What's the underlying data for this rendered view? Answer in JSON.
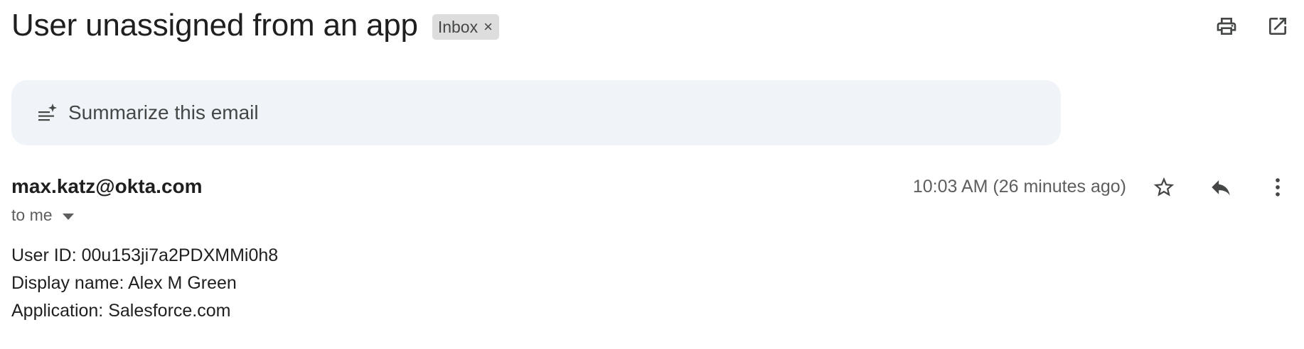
{
  "thread": {
    "subject": "User unassigned from an app",
    "label": "Inbox",
    "label_remove": "×"
  },
  "toolbar": {
    "print_icon": "printer-icon",
    "open_new_window_icon": "open-in-new-icon"
  },
  "summarize": {
    "label": "Summarize this email",
    "icon": "summarize-sparkle-icon"
  },
  "message": {
    "sender": "max.katz@okta.com",
    "recipient": "to me",
    "timestamp": "10:03 AM (26 minutes ago)",
    "body_lines": [
      "User ID: 00u153ji7a2PDXMMi0h8",
      "Display name: Alex M Green",
      "Application: Salesforce.com"
    ]
  },
  "colors": {
    "summarize_bg": "#f0f4f9",
    "chip_bg": "#dddddd",
    "text_primary": "#1f1f1f",
    "text_secondary": "#5e5e5e",
    "icon": "#444746"
  }
}
